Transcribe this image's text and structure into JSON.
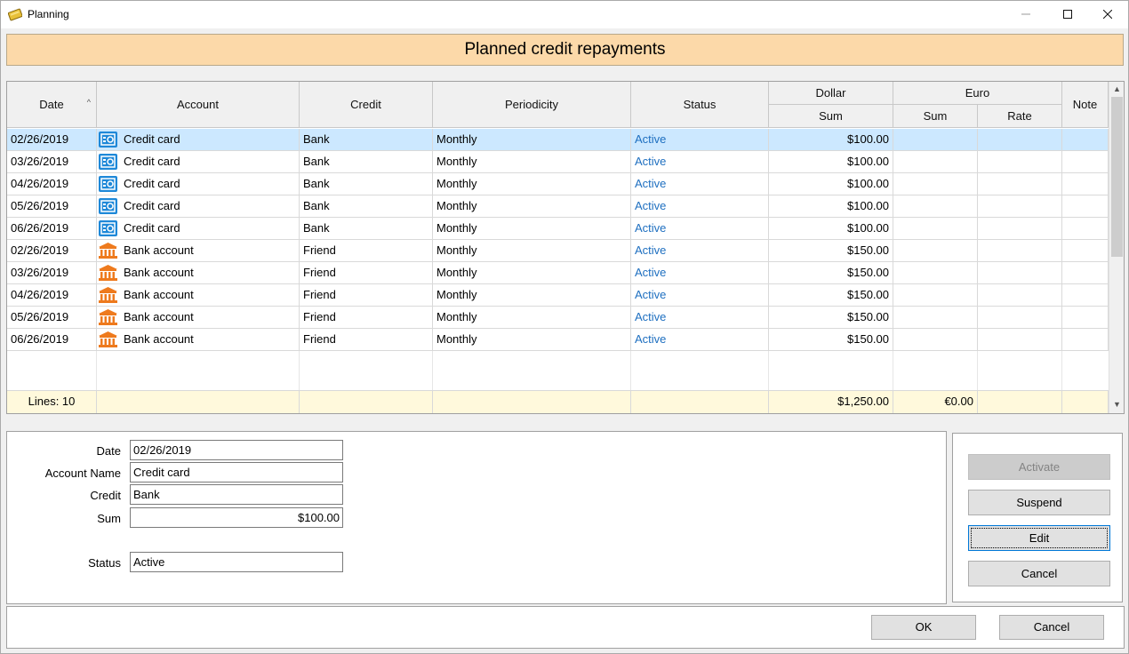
{
  "window": {
    "title": "Planning",
    "app_icon": "planning-app-icon"
  },
  "banner": {
    "title": "Planned credit repayments"
  },
  "table": {
    "headers": {
      "date": "Date",
      "account": "Account",
      "credit": "Credit",
      "periodicity": "Periodicity",
      "status": "Status",
      "dollar_group": "Dollar",
      "dollar_sum": "Sum",
      "euro_group": "Euro",
      "euro_sum": "Sum",
      "euro_rate": "Rate",
      "note": "Note"
    },
    "rows": [
      {
        "date": "02/26/2019",
        "account": "Credit card",
        "account_icon": "credit-card-icon",
        "credit": "Bank",
        "periodicity": "Monthly",
        "status": "Active",
        "dollar_sum": "$100.00",
        "euro_sum": "",
        "rate": "",
        "note": ""
      },
      {
        "date": "03/26/2019",
        "account": "Credit card",
        "account_icon": "credit-card-icon",
        "credit": "Bank",
        "periodicity": "Monthly",
        "status": "Active",
        "dollar_sum": "$100.00",
        "euro_sum": "",
        "rate": "",
        "note": ""
      },
      {
        "date": "04/26/2019",
        "account": "Credit card",
        "account_icon": "credit-card-icon",
        "credit": "Bank",
        "periodicity": "Monthly",
        "status": "Active",
        "dollar_sum": "$100.00",
        "euro_sum": "",
        "rate": "",
        "note": ""
      },
      {
        "date": "05/26/2019",
        "account": "Credit card",
        "account_icon": "credit-card-icon",
        "credit": "Bank",
        "periodicity": "Monthly",
        "status": "Active",
        "dollar_sum": "$100.00",
        "euro_sum": "",
        "rate": "",
        "note": ""
      },
      {
        "date": "06/26/2019",
        "account": "Credit card",
        "account_icon": "credit-card-icon",
        "credit": "Bank",
        "periodicity": "Monthly",
        "status": "Active",
        "dollar_sum": "$100.00",
        "euro_sum": "",
        "rate": "",
        "note": ""
      },
      {
        "date": "02/26/2019",
        "account": "Bank account",
        "account_icon": "bank-icon",
        "credit": "Friend",
        "periodicity": "Monthly",
        "status": "Active",
        "dollar_sum": "$150.00",
        "euro_sum": "",
        "rate": "",
        "note": ""
      },
      {
        "date": "03/26/2019",
        "account": "Bank account",
        "account_icon": "bank-icon",
        "credit": "Friend",
        "periodicity": "Monthly",
        "status": "Active",
        "dollar_sum": "$150.00",
        "euro_sum": "",
        "rate": "",
        "note": ""
      },
      {
        "date": "04/26/2019",
        "account": "Bank account",
        "account_icon": "bank-icon",
        "credit": "Friend",
        "periodicity": "Monthly",
        "status": "Active",
        "dollar_sum": "$150.00",
        "euro_sum": "",
        "rate": "",
        "note": ""
      },
      {
        "date": "05/26/2019",
        "account": "Bank account",
        "account_icon": "bank-icon",
        "credit": "Friend",
        "periodicity": "Monthly",
        "status": "Active",
        "dollar_sum": "$150.00",
        "euro_sum": "",
        "rate": "",
        "note": ""
      },
      {
        "date": "06/26/2019",
        "account": "Bank account",
        "account_icon": "bank-icon",
        "credit": "Friend",
        "periodicity": "Monthly",
        "status": "Active",
        "dollar_sum": "$150.00",
        "euro_sum": "",
        "rate": "",
        "note": ""
      }
    ],
    "selected_row": 0,
    "footer": {
      "lines": "Lines: 10",
      "dollar_total": "$1,250.00",
      "euro_total": "€0.00"
    }
  },
  "details": {
    "date_label": "Date",
    "date_value": "02/26/2019",
    "account_label": "Account Name",
    "account_value": "Credit card",
    "credit_label": "Credit",
    "credit_value": "Bank",
    "sum_label": "Sum",
    "sum_value": "$100.00",
    "status_label": "Status",
    "status_value": "Active"
  },
  "actions": {
    "activate": "Activate",
    "suspend": "Suspend",
    "edit": "Edit",
    "cancel": "Cancel"
  },
  "dialog": {
    "ok": "OK",
    "cancel": "Cancel"
  },
  "colors": {
    "banner": "#fcd9a9",
    "selected_row": "#cce8ff",
    "status_active": "#1e6fc0",
    "footer_row": "#fff9dc",
    "credit_card_icon": "#1e88d8",
    "bank_icon": "#ee7a1d"
  }
}
